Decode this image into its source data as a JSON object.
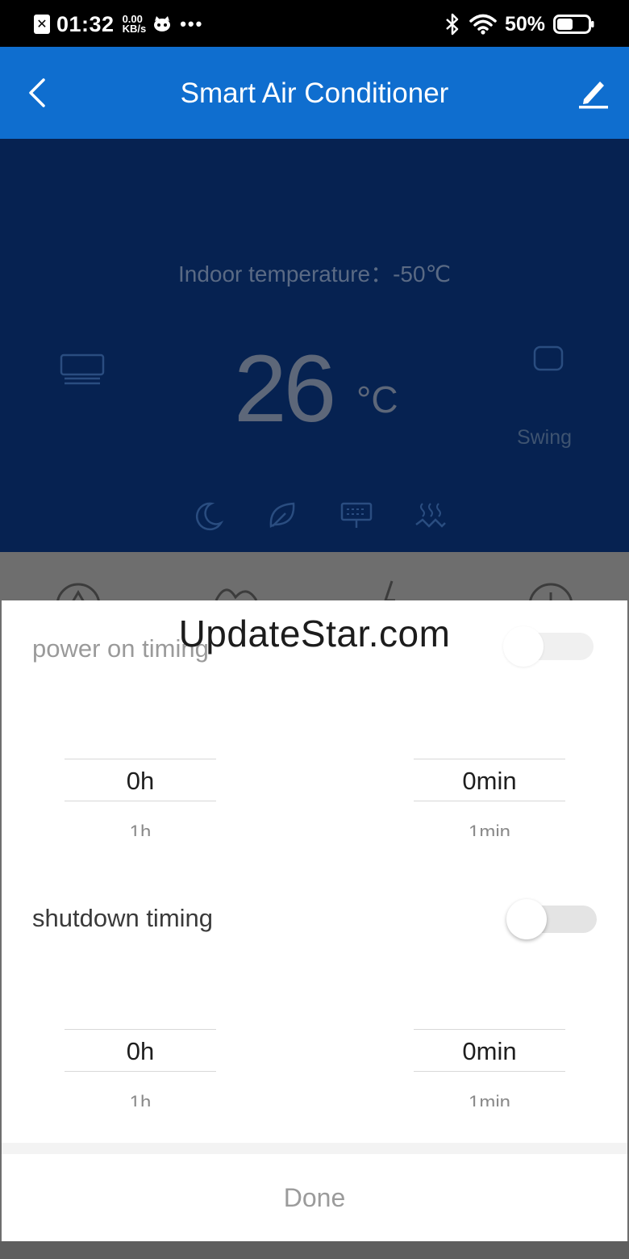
{
  "status_bar": {
    "notification_glyph": "✕",
    "time": "01:32",
    "speed_value": "0.00",
    "speed_unit": "KB/s",
    "more": "•••",
    "battery_percent": "50%",
    "battery_level": 0.5
  },
  "app_bar": {
    "title": "Smart Air Conditioner",
    "back_icon": "chevron-left-icon",
    "edit_icon": "pencil-icon"
  },
  "ac_panel": {
    "indoor_label": "Indoor temperature：-50℃",
    "temperature": "26",
    "temperature_unit": "°C",
    "swing_label": "Swing",
    "function_icons": [
      "moon-icon",
      "leaf-icon",
      "display-icon",
      "heat-icon"
    ]
  },
  "timing_sheet": {
    "power_on": {
      "label": "power on timing",
      "enabled": false,
      "hours": "0h",
      "hours_next": "1h",
      "minutes": "0min",
      "minutes_next": "1min"
    },
    "shutdown": {
      "label": "shutdown timing",
      "enabled": false,
      "hours": "0h",
      "hours_next": "1h",
      "minutes": "0min",
      "minutes_next": "1min"
    },
    "done_label": "Done"
  },
  "watermark": "UpdateStar.com",
  "colors": {
    "app_bar": "#0f6ecf",
    "panel": "#062251",
    "overlay": "#6e6e6e",
    "sheet": "#ffffff"
  }
}
